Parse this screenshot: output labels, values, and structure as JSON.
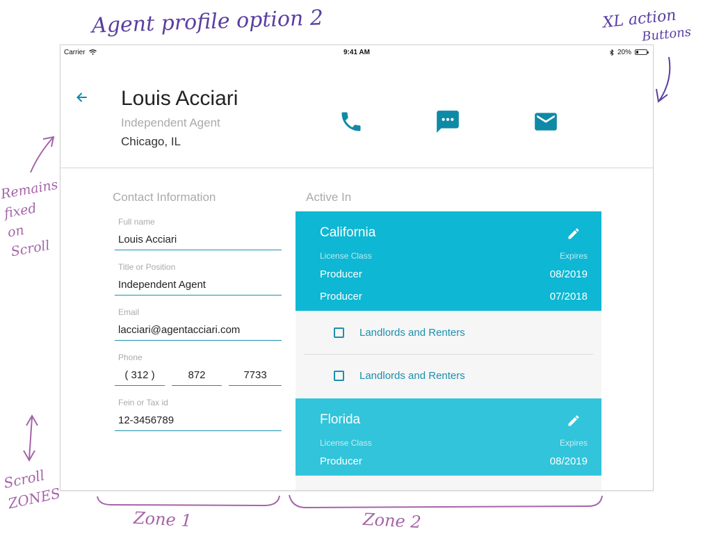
{
  "annotations": {
    "title": "Agent profile option 2",
    "xl_line1": "XL action",
    "xl_line2": "Buttons",
    "remains": [
      "Remains",
      "fixed",
      "on",
      "Scroll"
    ],
    "scroll": [
      "Scroll",
      "ZONES"
    ],
    "zone1": "Zone 1",
    "zone2": "Zone 2"
  },
  "status_bar": {
    "carrier": "Carrier",
    "time": "9:41 AM",
    "battery_text": "20%",
    "battery_level": 0.2
  },
  "profile": {
    "name": "Louis Acciari",
    "role": "Independent Agent",
    "location": "Chicago, IL",
    "actions": [
      {
        "icon": "phone-icon",
        "color": "#0e8aa6"
      },
      {
        "icon": "chat-icon",
        "color": "#0e8aa6"
      },
      {
        "icon": "mail-icon",
        "color": "#0e8aa6"
      }
    ]
  },
  "contact": {
    "title": "Contact Information",
    "fields": [
      {
        "label": "Full name",
        "value": "Louis Acciari"
      },
      {
        "label": "Title or Position",
        "value": "Independent Agent"
      },
      {
        "label": "Email",
        "value": "lacciari@agentacciari.com"
      },
      {
        "label": "Phone",
        "value": ""
      },
      {
        "label": "Fein or Tax id",
        "value": "12-3456789"
      }
    ],
    "phone": {
      "area": "( 312 )",
      "prefix": "872",
      "line": "7733"
    }
  },
  "active_in": {
    "title": "Active In",
    "license_class_label": "License Class",
    "expires_label": "Expires",
    "states": [
      {
        "name": "California",
        "licenses": [
          {
            "class": "Producer",
            "expires": "08/2019"
          },
          {
            "class": "Producer",
            "expires": "07/2018"
          }
        ],
        "endorsements": [
          "Landlords and Renters",
          "Landlords and Renters"
        ]
      },
      {
        "name": "Florida",
        "licenses": [
          {
            "class": "Producer",
            "expires": "08/2019"
          }
        ],
        "endorsements": []
      }
    ]
  },
  "colors": {
    "accent": "#0e8aa6",
    "california_card": "#0eb7d3",
    "florida_card": "#31c4da",
    "annotation_purple": "#5a3ea0",
    "annotation_pink": "#a564a8"
  }
}
